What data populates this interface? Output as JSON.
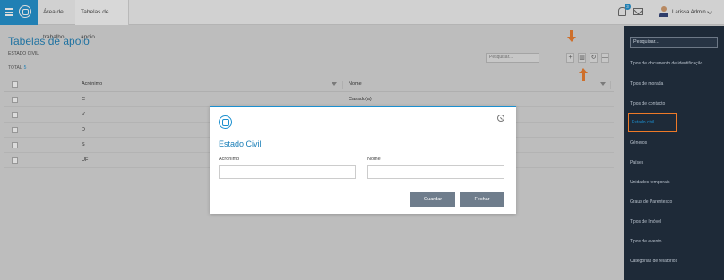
{
  "header": {
    "tabs": [
      {
        "label": "Área de trabalho"
      },
      {
        "label": "Tabelas de apoio"
      }
    ],
    "notifications_count": "3",
    "user_name": "Larissa Admin"
  },
  "main": {
    "title": "Tabelas de apoio",
    "entity": "ESTADO CIVIL",
    "total_label": "TOTAL",
    "total_value": "5",
    "search_placeholder": "Pesquisar...",
    "toolbar": {
      "add": "+",
      "columns": "▥",
      "refresh": "↻",
      "remove": "—"
    },
    "columns": {
      "acronym": "Acrónimo",
      "name": "Nome"
    },
    "rows": [
      {
        "acronym": "C",
        "name": "Casado(a)"
      },
      {
        "acronym": "V",
        "name": ""
      },
      {
        "acronym": "D",
        "name": ""
      },
      {
        "acronym": "S",
        "name": ""
      },
      {
        "acronym": "UF",
        "name": ""
      }
    ]
  },
  "sidebar": {
    "search_placeholder": "Pesquisar...",
    "items": [
      {
        "label": "Tipos de documento de identificação"
      },
      {
        "label": "Tipos de morada"
      },
      {
        "label": "Tipos de contacto"
      },
      {
        "label": "Estado civil"
      },
      {
        "label": "Géneros"
      },
      {
        "label": "Países"
      },
      {
        "label": "Unidades temporais"
      },
      {
        "label": "Graus de Parentesco"
      },
      {
        "label": "Tipos de Imóvel"
      },
      {
        "label": "Tipos de evento"
      },
      {
        "label": "Categorias de relatórios"
      }
    ],
    "active_index": 3
  },
  "modal": {
    "title": "Estado Civil",
    "fields": {
      "acronym_label": "Acrónimo",
      "name_label": "Nome",
      "acronym_value": "",
      "name_value": ""
    },
    "save_label": "Guardar",
    "close_label": "Fechar"
  },
  "colors": {
    "accent": "#1b8fcf",
    "highlight": "#ee7a28",
    "sidebar_bg": "#1e2a38",
    "button": "#6f7d8c"
  }
}
